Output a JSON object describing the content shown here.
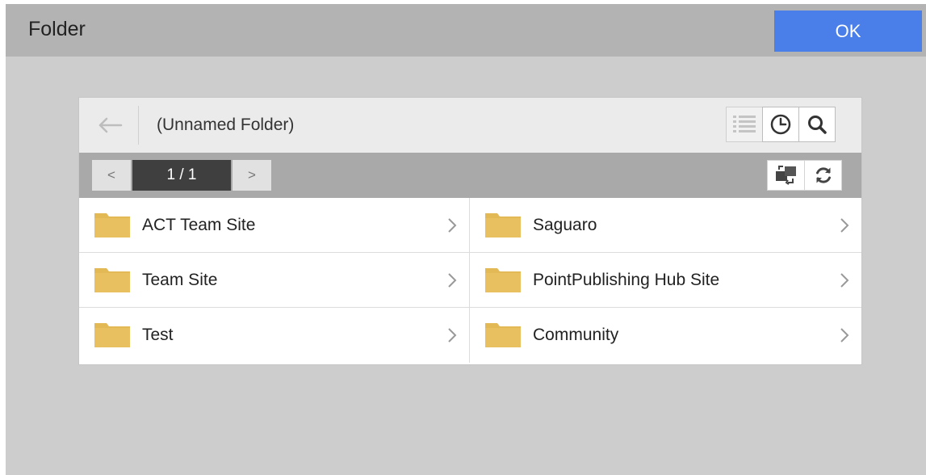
{
  "dialog": {
    "title": "Folder",
    "ok_label": "OK"
  },
  "browser": {
    "current_folder": "(Unnamed Folder)",
    "pager": {
      "prev_label": "<",
      "next_label": ">",
      "page_text": "1 / 1"
    },
    "folders": [
      {
        "label": "ACT Team Site"
      },
      {
        "label": "Saguaro"
      },
      {
        "label": "Team Site"
      },
      {
        "label": "PointPublishing Hub Site"
      },
      {
        "label": "Test"
      },
      {
        "label": "Community"
      }
    ]
  },
  "icons": {
    "back": "arrow-left-icon",
    "list": "list-icon",
    "clock": "clock-icon",
    "search": "search-icon",
    "switch": "switch-icon",
    "refresh": "refresh-icon",
    "folder": "folder-icon",
    "chevron": "chevron-right-icon"
  },
  "colors": {
    "accent": "#4a7fea",
    "folder": "#e2b955"
  }
}
